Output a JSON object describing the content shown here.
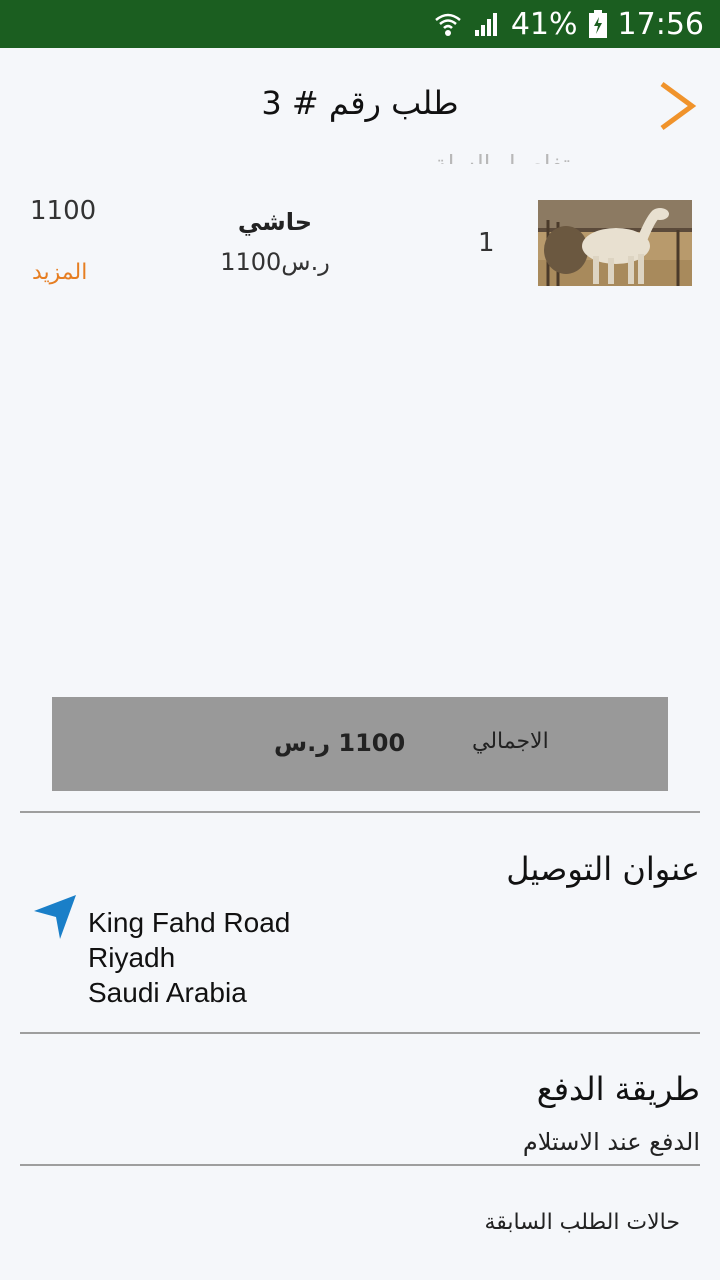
{
  "status_bar": {
    "battery": "41%",
    "time": "17:56",
    "icons": [
      "wifi-icon",
      "signal-icon",
      "battery-charging-icon"
    ],
    "background": "#1b5e20"
  },
  "header": {
    "title": "طلب رقم # 3",
    "back_icon": "chevron-right-icon",
    "accent": "#f0932b"
  },
  "cart": {
    "section_label": "تفاصيل السلة",
    "items": [
      {
        "image": "camel-photo",
        "quantity": "1",
        "name": "حاشي",
        "unit_price": "1100ر.س",
        "line_total": "1100",
        "more_label": "المزيد"
      }
    ],
    "total_label": "الاجمالي",
    "total_value": "1100 ر.س"
  },
  "delivery": {
    "title": "عنوان التوصيل",
    "icon": "navigation-arrow-icon",
    "address": [
      "King Fahd Road",
      "Riyadh",
      "Saudi Arabia"
    ]
  },
  "payment": {
    "title": "طريقة الدفع",
    "method": "الدفع عند الاستلام"
  },
  "history": {
    "link_label": "حالات الطلب السابقة"
  }
}
